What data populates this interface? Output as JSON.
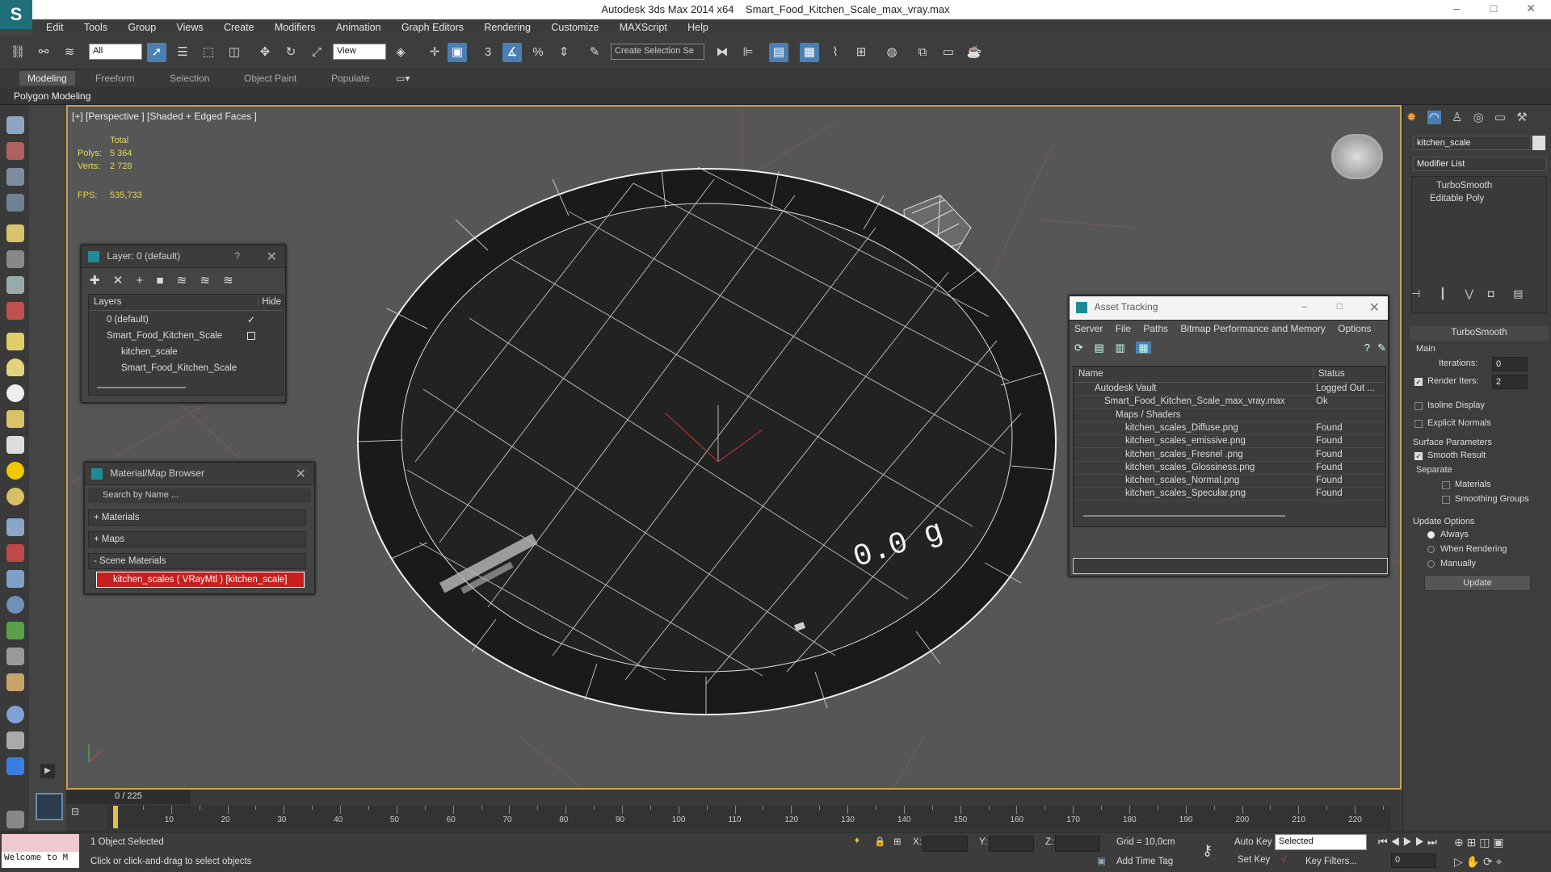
{
  "titlebar": {
    "app": "Autodesk 3ds Max  2014 x64",
    "file": "Smart_Food_Kitchen_Scale_max_vray.max",
    "min": "–",
    "max": "□",
    "close": "✕"
  },
  "menu": [
    "Edit",
    "Tools",
    "Group",
    "Views",
    "Create",
    "Modifiers",
    "Animation",
    "Graph Editors",
    "Rendering",
    "Customize",
    "MAXScript",
    "Help"
  ],
  "toolbar": {
    "selection_filter": "All",
    "ref_coord": "View",
    "named_set": "Create Selection Se"
  },
  "ribbon": {
    "tabs": [
      "Modeling",
      "Freeform",
      "Selection",
      "Object Paint",
      "Populate"
    ],
    "active": "Modeling",
    "sub": "Polygon Modeling"
  },
  "viewport": {
    "label": "[+] [Perspective ] [Shaded + Edged Faces ]",
    "stats": {
      "total_label": "Total",
      "polys_label": "Polys:",
      "polys": "5 364",
      "verts_label": "Verts:",
      "verts": "2 728",
      "fps_label": "FPS:",
      "fps": "535,733"
    },
    "scale_display": "0.0 g"
  },
  "layer_panel": {
    "title": "Layer: 0 (default)",
    "help": "?",
    "col_layers": "Layers",
    "col_hide": "Hide",
    "rows": [
      "0 (default)",
      "Smart_Food_Kitchen_Scale",
      "kitchen_scale",
      "Smart_Food_Kitchen_Scale"
    ]
  },
  "material_browser": {
    "title": "Material/Map Browser",
    "search_placeholder": "Search by Name ...",
    "groups": [
      "+ Materials",
      "+ Maps",
      "- Scene Materials"
    ],
    "scene_item": "kitchen_scales  ( VRayMtl ) [kitchen_scale]"
  },
  "asset_tracking": {
    "title": "Asset Tracking",
    "menu": [
      "Server",
      "File",
      "Paths",
      "Bitmap Performance and Memory",
      "Options"
    ],
    "col_name": "Name",
    "col_status": "Status",
    "rows": [
      {
        "name": "Autodesk Vault",
        "status": "Logged Out ..."
      },
      {
        "name": "Smart_Food_Kitchen_Scale_max_vray.max",
        "status": "Ok"
      },
      {
        "name": "Maps / Shaders",
        "status": ""
      },
      {
        "name": "kitchen_scales_Diffuse.png",
        "status": "Found"
      },
      {
        "name": "kitchen_scales_emissive.png",
        "status": "Found"
      },
      {
        "name": "kitchen_scales_Fresnel .png",
        "status": "Found"
      },
      {
        "name": "kitchen_scales_Glossiness.png",
        "status": "Found"
      },
      {
        "name": "kitchen_scales_Normal.png",
        "status": "Found"
      },
      {
        "name": "kitchen_scales_Specular.png",
        "status": "Found"
      }
    ]
  },
  "command_panel": {
    "object_name": "kitchen_scale",
    "modifier_list": "Modifier List",
    "stack": [
      "TurboSmooth",
      "Editable Poly"
    ],
    "rollout_title": "TurboSmooth",
    "main_label": "Main",
    "iterations_label": "Iterations:",
    "iterations": "0",
    "render_iters_label": "Render Iters:",
    "render_iters": "2",
    "isoline": "Isoline Display",
    "explicit_normals": "Explicit Normals",
    "surface_params": "Surface Parameters",
    "smooth_result": "Smooth Result",
    "separate": "Separate",
    "materials": "Materials",
    "smoothing_groups": "Smoothing Groups",
    "update_options": "Update Options",
    "always": "Always",
    "when_rendering": "When Rendering",
    "manually": "Manually",
    "update_btn": "Update"
  },
  "timeline": {
    "frame": "0 / 225",
    "ticks": [
      "10",
      "20",
      "30",
      "40",
      "50",
      "60",
      "70",
      "80",
      "90",
      "100",
      "110",
      "120",
      "130",
      "140",
      "150",
      "160",
      "170",
      "180",
      "190",
      "200",
      "210",
      "220"
    ]
  },
  "status": {
    "welcome": "Welcome to M",
    "selected": "1 Object Selected",
    "prompt": "Click or click-and-drag to select objects",
    "x_label": "X:",
    "y_label": "Y:",
    "z_label": "Z:",
    "grid": "Grid = 10,0cm",
    "add_time_tag": "Add Time Tag",
    "auto_key": "Auto Key",
    "set_key": "Set Key",
    "key_mode": "Selected",
    "key_filters": "Key Filters...",
    "frame_field": "0"
  }
}
